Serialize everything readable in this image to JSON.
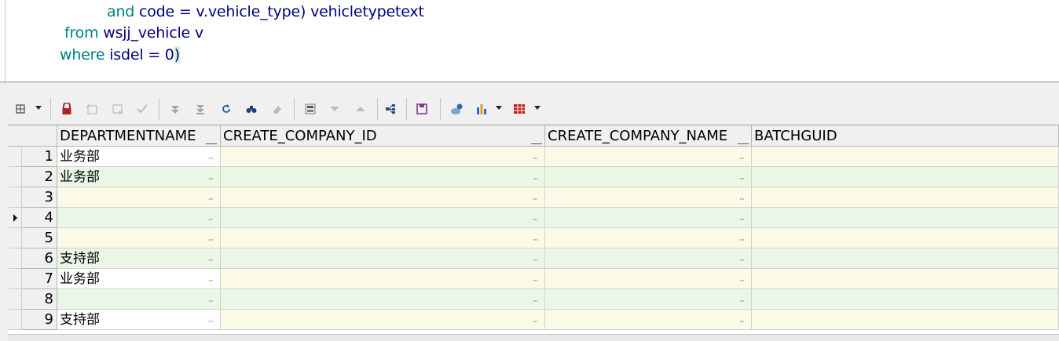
{
  "editor": {
    "line1": {
      "kw": "and",
      "rest": " code = v.vehicle_type) vehicletypetext"
    },
    "line2": {
      "kw": "from",
      "rest": " wsjj_vehicle v"
    },
    "line3": {
      "kw": "where",
      "rest": " isdel = 0",
      "paren": ")"
    }
  },
  "toolbar": {
    "icons": [
      "grid-options-icon",
      "lock-icon",
      "add-record-icon",
      "delete-record-icon",
      "post-changes-icon",
      "fetch-next-icon",
      "fetch-last-icon",
      "refresh-icon",
      "find-icon",
      "clear-icon",
      "query-by-example-icon",
      "sort-desc-icon",
      "sort-asc-icon",
      "record-tree-icon",
      "save-icon",
      "link-icon",
      "chart-icon",
      "export-icon"
    ]
  },
  "grid": {
    "columns": [
      "DEPARTMENTNAME",
      "CREATE_COMPANY_ID",
      "CREATE_COMPANY_NAME",
      "BATCHGUID"
    ],
    "rows": [
      {
        "num": "1",
        "dept": "业务部"
      },
      {
        "num": "2",
        "dept": "业务部"
      },
      {
        "num": "3",
        "dept": ""
      },
      {
        "num": "4",
        "dept": ""
      },
      {
        "num": "5",
        "dept": ""
      },
      {
        "num": "6",
        "dept": "支持部"
      },
      {
        "num": "7",
        "dept": "业务部"
      },
      {
        "num": "8",
        "dept": ""
      },
      {
        "num": "9",
        "dept": "支持部"
      }
    ],
    "ellipsis": "···",
    "current_row": "4"
  },
  "colors": {
    "keyword": "#008080",
    "identifier": "#000080",
    "row_yellow": "#fafae6",
    "row_green": "#eaf7e6"
  }
}
